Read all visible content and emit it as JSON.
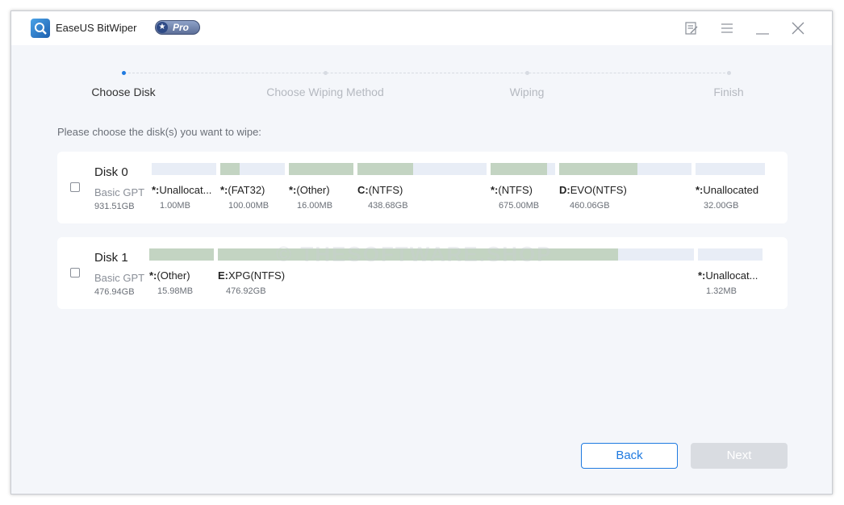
{
  "app": {
    "title": "EaseUS BitWiper",
    "badge": "Pro"
  },
  "steps": [
    {
      "label": "Choose Disk",
      "active": true
    },
    {
      "label": "Choose Wiping Method",
      "active": false
    },
    {
      "label": "Wiping",
      "active": false
    },
    {
      "label": "Finish",
      "active": false
    }
  ],
  "instruction": "Please choose the disk(s) you want to wipe:",
  "disks": [
    {
      "name": "Disk 0",
      "type": "Basic GPT",
      "size": "931.51GB",
      "partitions": [
        {
          "prefix": "*:",
          "name": "Unallocat...",
          "size": "1.00MB",
          "used": 0
        },
        {
          "prefix": "*:",
          "name": "(FAT32)",
          "size": "100.00MB",
          "used": 0.3
        },
        {
          "prefix": "*:",
          "name": "(Other)",
          "size": "16.00MB",
          "used": 1.0
        },
        {
          "prefix": "C:",
          "name": "(NTFS)",
          "size": "438.68GB",
          "used": 0.43
        },
        {
          "prefix": "*:",
          "name": "(NTFS)",
          "size": "675.00MB",
          "used": 0.88
        },
        {
          "prefix": "D:",
          "name": "EVO(NTFS)",
          "size": "460.06GB",
          "used": 0.59
        },
        {
          "prefix": "*:",
          "name": "Unallocated",
          "size": "32.00GB",
          "used": 0
        }
      ]
    },
    {
      "name": "Disk 1",
      "type": "Basic GPT",
      "size": "476.94GB",
      "partitions": [
        {
          "prefix": "*:",
          "name": "(Other)",
          "size": "15.98MB",
          "used": 1.0
        },
        {
          "prefix": "E:",
          "name": "XPG(NTFS)",
          "size": "476.92GB",
          "used": 0.84
        },
        {
          "prefix": "*:",
          "name": "Unallocat...",
          "size": "1.32MB",
          "used": 0
        }
      ]
    }
  ],
  "watermark": "© THESOFTWARE.SHOP",
  "buttons": {
    "back": "Back",
    "next": "Next"
  }
}
